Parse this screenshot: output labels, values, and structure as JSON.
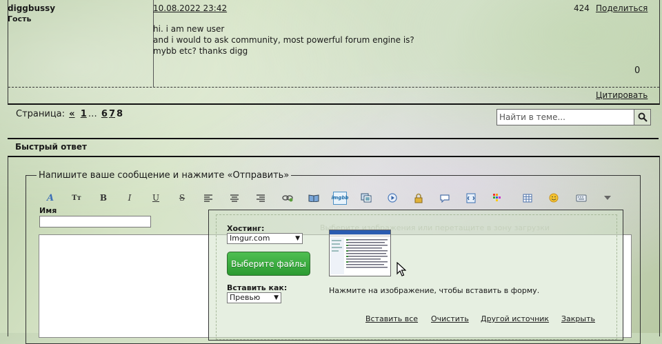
{
  "post": {
    "username": "diggbussy",
    "role": "Гость",
    "date": "10.08.2022 23:42",
    "number": "424",
    "share": "Поделиться",
    "body": [
      "hi. i am new user",
      "and i would to ask community, most powerful forum engine is?",
      "mybb etc? thanks digg"
    ],
    "reputation": "0",
    "quote": "Цитировать"
  },
  "pagination": {
    "label": "Страница:",
    "prev": "«",
    "pages": [
      "1",
      "…",
      "6",
      "7"
    ],
    "current": "8"
  },
  "search": {
    "placeholder": "Найти в теме..."
  },
  "quick_reply": {
    "title": "Быстрый ответ",
    "legend": "Напишите ваше сообщение и нажмите «Отправить»",
    "name_label": "Имя",
    "name_value": ""
  },
  "toolbar": {
    "icons": [
      "font-icon",
      "font-size-icon",
      "bold-icon",
      "italic-icon",
      "underline-icon",
      "strikethrough-icon",
      "align-left-icon",
      "align-center-icon",
      "align-right-icon",
      "link-icon",
      "book-icon",
      "imgbb-icon",
      "gallery-icon",
      "video-icon",
      "lock-icon",
      "speech-bubble-icon",
      "code-icon",
      "color-icon",
      "table-icon",
      "smiley-icon",
      "keyboard-icon",
      "more-icon"
    ]
  },
  "upload": {
    "drop_hint": "Выберите изображения или перетащите в зону загрузки",
    "hosting_label": "Хостинг:",
    "hosting_value": "Imgur.com",
    "choose_file": "Выберите файлы",
    "insert_as_label": "Вставить как:",
    "insert_as_value": "Превью",
    "thumb_hint": "Нажмите на изображение, чтобы вставить в форму.",
    "links": [
      "Вставить все",
      "Очистить",
      "Другой источник",
      "Закрыть"
    ]
  }
}
